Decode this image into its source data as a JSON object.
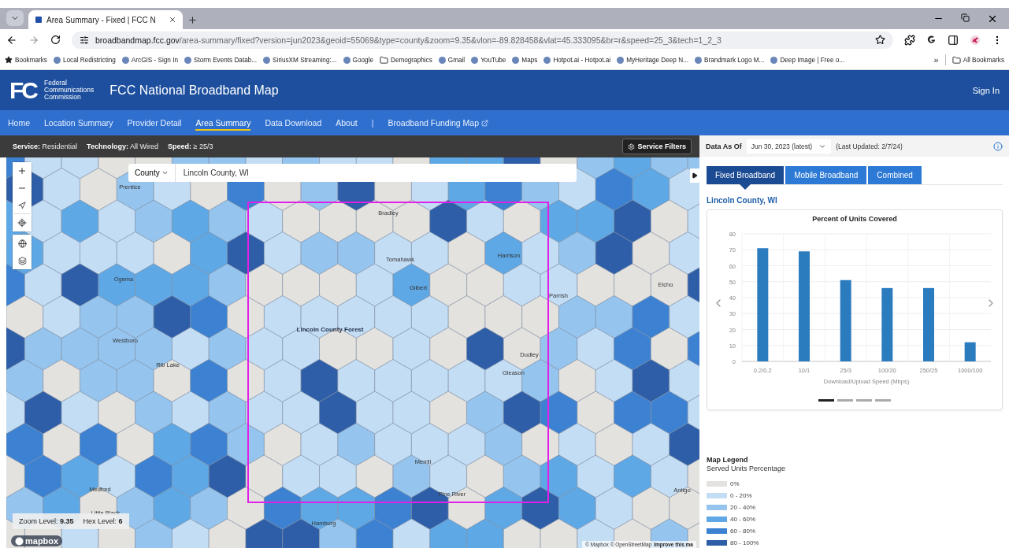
{
  "browser": {
    "tab_title": "Area Summary - Fixed | FCC N",
    "url_host": "broadbandmap.fcc.gov",
    "url_path": "/area-summary/fixed?version=jun2023&geoid=55069&type=county&zoom=9.35&vlon=-89.828458&vlat=45.333095&br=r&speed=25_3&tech=1_2_3",
    "bookmarks": [
      {
        "label": "Bookmarks",
        "kind": "star"
      },
      {
        "label": "Local Redistricting",
        "kind": "site"
      },
      {
        "label": "ArcGIS - Sign In",
        "kind": "site"
      },
      {
        "label": "Storm Events Datab...",
        "kind": "site"
      },
      {
        "label": "SiriusXM Streaming:...",
        "kind": "site"
      },
      {
        "label": "Google",
        "kind": "site"
      },
      {
        "label": "Demographics",
        "kind": "folder"
      },
      {
        "label": "Gmail",
        "kind": "site"
      },
      {
        "label": "YouTube",
        "kind": "site"
      },
      {
        "label": "Maps",
        "kind": "site"
      },
      {
        "label": "Hotpot.ai - Hotpot.ai",
        "kind": "site"
      },
      {
        "label": "MyHeritage Deep N...",
        "kind": "site"
      },
      {
        "label": "Brandmark Logo M...",
        "kind": "site"
      },
      {
        "label": "Deep Image | Free o...",
        "kind": "site"
      }
    ],
    "overflow": "»",
    "all_bookmarks": "All Bookmarks"
  },
  "header": {
    "logo_mark": "FC",
    "agency_lines": [
      "Federal",
      "Communications",
      "Commission"
    ],
    "title": "FCC National Broadband Map",
    "sign_in": "Sign In"
  },
  "nav": [
    {
      "label": "Home",
      "kind": "link",
      "selected": false
    },
    {
      "label": "Location Summary",
      "kind": "link",
      "selected": false
    },
    {
      "label": "Provider Detail",
      "kind": "link",
      "selected": false
    },
    {
      "label": "Area Summary",
      "kind": "link",
      "selected": true
    },
    {
      "label": "Data Download",
      "kind": "link",
      "selected": false
    },
    {
      "label": "About",
      "kind": "link",
      "selected": false
    },
    {
      "label": "|",
      "kind": "separator"
    },
    {
      "label": "Broadband Funding Map",
      "kind": "external",
      "selected": false
    }
  ],
  "filter_bar": {
    "items": [
      "**Service:** Residential",
      "**Technology:** All Wired",
      "**Speed:** ≥ 25/3"
    ],
    "button": "Service Filters"
  },
  "map": {
    "search": {
      "type": "County",
      "value": "Lincoln County, WI"
    },
    "labels": [
      {
        "text": "Prentice",
        "kind": "town"
      },
      {
        "text": "Bradley",
        "kind": "town"
      },
      {
        "text": "Tomahawk",
        "kind": "town"
      },
      {
        "text": "Harrison",
        "kind": "town"
      },
      {
        "text": "Gilbert",
        "kind": "town"
      },
      {
        "text": "Parrish",
        "kind": "town"
      },
      {
        "text": "Elcho",
        "kind": "town"
      },
      {
        "text": "Ogema",
        "kind": "town"
      },
      {
        "text": "Lincoln County Forest",
        "kind": "area"
      },
      {
        "text": "Westboro",
        "kind": "town"
      },
      {
        "text": "Dudley",
        "kind": "town"
      },
      {
        "text": "Rib Lake",
        "kind": "town"
      },
      {
        "text": "Gleason",
        "kind": "town"
      },
      {
        "text": "Merrill",
        "kind": "town"
      },
      {
        "text": "Pine River",
        "kind": "town"
      },
      {
        "text": "Medford",
        "kind": "town"
      },
      {
        "text": "Antigo",
        "kind": "town"
      },
      {
        "text": "Little Black",
        "kind": "town"
      },
      {
        "text": "Hamburg",
        "kind": "town"
      }
    ],
    "zoom_info": [
      "Zoom Level: **9.35**",
      "Hex Level: **6**"
    ],
    "logo": "mapbox",
    "attribution": "© Mapbox © OpenStreetMap",
    "attribution_link": "Improve this ma"
  },
  "panel": {
    "data_as_of": "Data As Of",
    "date": "Jun 30, 2023 (latest)",
    "last_updated": "(Last Updated: 2/7/24)",
    "tabs": [
      {
        "label": "Fixed Broadband",
        "selected": true
      },
      {
        "label": "Mobile Broadband",
        "selected": false
      },
      {
        "label": "Combined",
        "selected": false
      }
    ],
    "area_title": "Lincoln County, WI",
    "chart_data": {
      "type": "bar",
      "title": "Percent of Units Covered",
      "xlabel": "Download/Upload Speed (Mbps)",
      "categories": [
        "0.2/0.2",
        "10/1",
        "25/3",
        "100/20",
        "250/25",
        "1000/100"
      ],
      "series": [
        {
          "color": "#2b7bbf",
          "values": [
            71,
            69,
            51,
            46,
            46,
            12
          ]
        }
      ],
      "grid": true,
      "ylim": [
        0,
        80
      ],
      "yticks": [
        0,
        10,
        20,
        30,
        40,
        50,
        60,
        70,
        80
      ]
    },
    "pages": [
      {
        "selected": true
      },
      {
        "selected": false
      },
      {
        "selected": false
      },
      {
        "selected": false
      }
    ],
    "legend": {
      "title": "Map Legend",
      "subtitle": "Served Units Percentage",
      "items": [
        {
          "label": "0%",
          "color": "#e4e2df"
        },
        {
          "label": "0 - 20%",
          "color": "#c3ddf5"
        },
        {
          "label": "20 - 40%",
          "color": "#95c5ef"
        },
        {
          "label": "40 - 60%",
          "color": "#5ea8e6"
        },
        {
          "label": "60 - 80%",
          "color": "#3d82d2"
        },
        {
          "label": "80 - 100%",
          "color": "#2e5ea8"
        }
      ]
    }
  }
}
